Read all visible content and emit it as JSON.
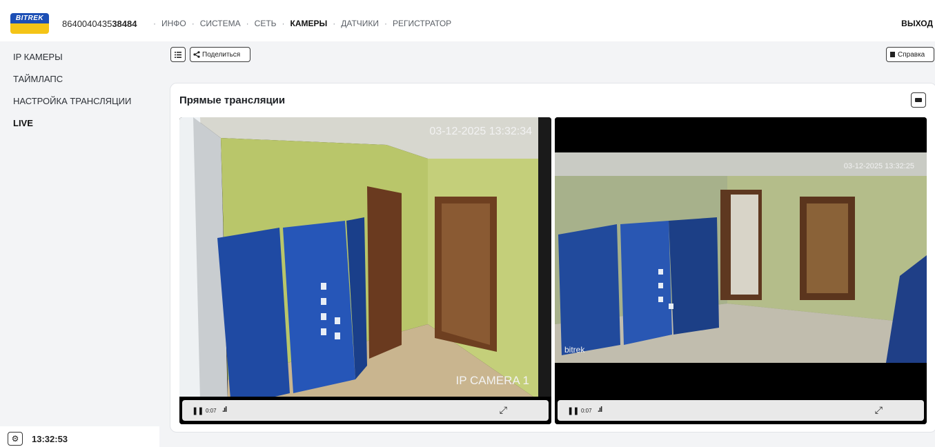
{
  "header": {
    "logo_text": "BITREK",
    "device_id_prefix": "8640040435",
    "device_id_suffix": "38484",
    "nav": [
      "ИНФО",
      "СИСТЕМА",
      "СЕТЬ",
      "КАМЕРЫ",
      "ДАТЧИКИ",
      "РЕГИСТРАТОР"
    ],
    "active_nav": "КАМЕРЫ",
    "logout_label": "ВЫХОД"
  },
  "sidebar": {
    "items": [
      {
        "label": "IP КАМЕРЫ"
      },
      {
        "label": "ТАЙМЛАПС"
      },
      {
        "label": "НАСТРОЙКА ТРАНСЛЯЦИИ"
      },
      {
        "label": "LIVE"
      }
    ],
    "active": "LIVE",
    "clock": "13:32:53"
  },
  "toolbar": {
    "share_label": "Поделиться",
    "help_label": "Справка"
  },
  "panel": {
    "title": "Прямые трансляции",
    "videos": [
      {
        "timestamp": "03-12-2025 13:32:34",
        "camera_label": "IP CAMERA 1",
        "time": "0:07"
      },
      {
        "timestamp": "03-12-2025 13:32:25",
        "camera_label": "bitrek",
        "time": "0:07"
      }
    ]
  }
}
